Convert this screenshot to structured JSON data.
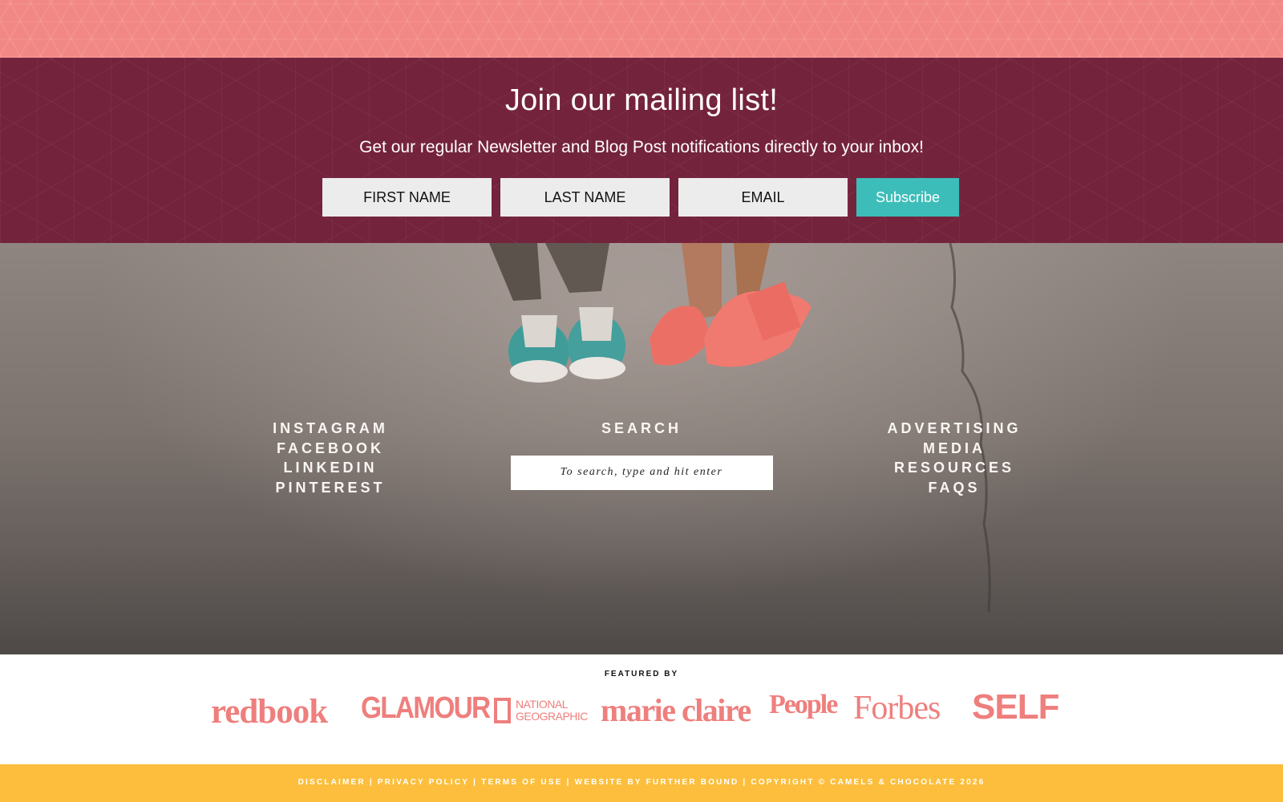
{
  "mailing": {
    "title": "Join our mailing list!",
    "subtitle": "Get our regular Newsletter and Blog Post notifications directly to your inbox!",
    "first_name_placeholder": "FIRST NAME",
    "last_name_placeholder": "LAST NAME",
    "email_placeholder": "EMAIL",
    "subscribe_label": "Subscribe"
  },
  "social_links": [
    "INSTAGRAM",
    "FACEBOOK",
    "LINKEDIN",
    "PINTEREST"
  ],
  "search": {
    "heading": "SEARCH",
    "placeholder": "To search, type and hit enter"
  },
  "info_links": [
    "ADVERTISING",
    "MEDIA",
    "RESOURCES",
    "FAQS"
  ],
  "featured": {
    "label": "FEATURED BY",
    "logos": {
      "redbook": "redbook",
      "glamour": "GLAMOUR",
      "natgeo_line1": "NATIONAL",
      "natgeo_line2": "GEOGRAPHIC",
      "marie_claire": "marie claire",
      "people": "People",
      "forbes": "Forbes",
      "self": "SELF"
    }
  },
  "legal": {
    "disclaimer": "DISCLAIMER",
    "privacy": "PRIVACY POLICY",
    "terms": "TERMS OF USE",
    "website_by": "WEBSITE BY FURTHER BOUND",
    "copyright": "COPYRIGHT © CAMELS & CHOCOLATE 2026"
  },
  "colors": {
    "coral": "#f28885",
    "maroon": "#74233c",
    "teal": "#3dbdb9",
    "logo_pink": "#ee7f7d",
    "mustard": "#fcbe3c"
  },
  "icons": [
    "natgeo-frame-icon"
  ]
}
